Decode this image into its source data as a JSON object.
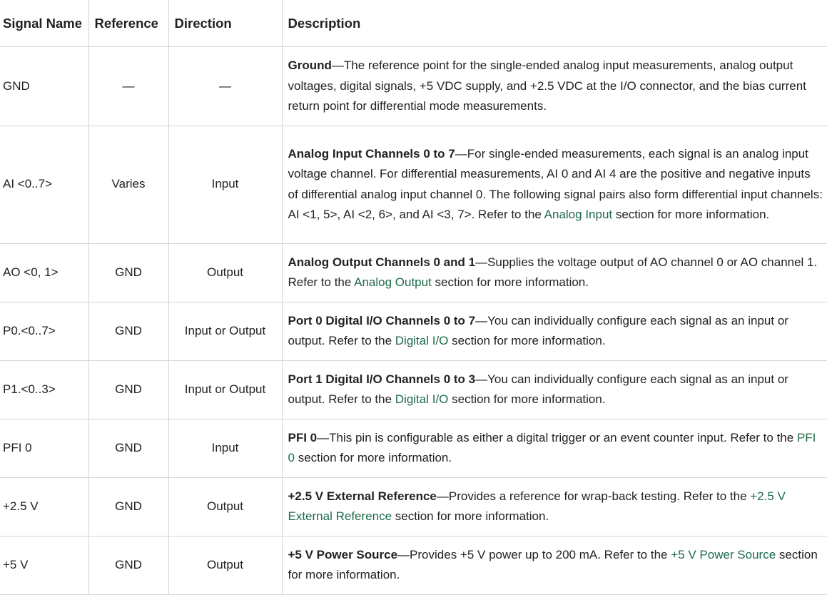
{
  "headers": {
    "signal_name": "Signal Name",
    "reference": "Reference",
    "direction": "Direction",
    "description": "Description"
  },
  "rows": [
    {
      "signal": "GND",
      "reference": "—",
      "direction": "—",
      "desc_title": "Ground",
      "desc_text": "—The reference point for the single-ended analog input measurements, analog output voltages, digital signals, +5 VDC supply, and +2.5 VDC at the I/O connector, and the bias current return point for differential mode measurements.",
      "link": "",
      "desc_after": ""
    },
    {
      "signal": "AI <0..7>",
      "reference": "Varies",
      "direction": "Input",
      "desc_title": "Analog Input Channels 0 to 7",
      "desc_text": "—For single-ended measurements, each signal is an analog input voltage channel. For differential measurements, AI 0 and AI 4 are the positive and negative inputs of differential analog input channel 0. The following signal pairs also form differential input channels: AI <1, 5>, AI <2, 6>, and AI <3, 7>. Refer to the ",
      "link": "Analog Input",
      "desc_after": " section for more information."
    },
    {
      "signal": "AO <0, 1>",
      "reference": "GND",
      "direction": "Output",
      "desc_title": "Analog Output Channels 0 and 1",
      "desc_text": "—Supplies the voltage output of AO channel 0 or AO channel 1. Refer to the ",
      "link": "Analog Output",
      "desc_after": " section for more information."
    },
    {
      "signal": "P0.<0..7>",
      "reference": "GND",
      "direction": "Input or Output",
      "desc_title": "Port 0 Digital I/O Channels 0 to 7",
      "desc_text": "—You can individually configure each signal as an input or output. Refer to the ",
      "link": "Digital I/O",
      "desc_after": " section for more information."
    },
    {
      "signal": "P1.<0..3>",
      "reference": "GND",
      "direction": "Input or Output",
      "desc_title": "Port 1 Digital I/O Channels 0 to 3",
      "desc_text": "—You can individually configure each signal as an input or output. Refer to the ",
      "link": "Digital I/O",
      "desc_after": " section for more information."
    },
    {
      "signal": "PFI 0",
      "reference": "GND",
      "direction": "Input",
      "desc_title": "PFI 0",
      "desc_text": "—This pin is configurable as either a digital trigger or an event counter input. Refer to the ",
      "link": "PFI 0",
      "desc_after": " section for more information."
    },
    {
      "signal": "+2.5 V",
      "reference": "GND",
      "direction": "Output",
      "desc_title": "+2.5 V External Reference",
      "desc_text": "—Provides a reference for wrap-back testing. Refer to the ",
      "link": "+2.5 V External Reference",
      "desc_after": " section for more information."
    },
    {
      "signal": "+5 V",
      "reference": "GND",
      "direction": "Output",
      "desc_title": "+5 V Power Source",
      "desc_text": "—Provides +5 V power up to 200 mA. Refer to the ",
      "link": "+5 V Power Source",
      "desc_after": " section for more information."
    }
  ]
}
